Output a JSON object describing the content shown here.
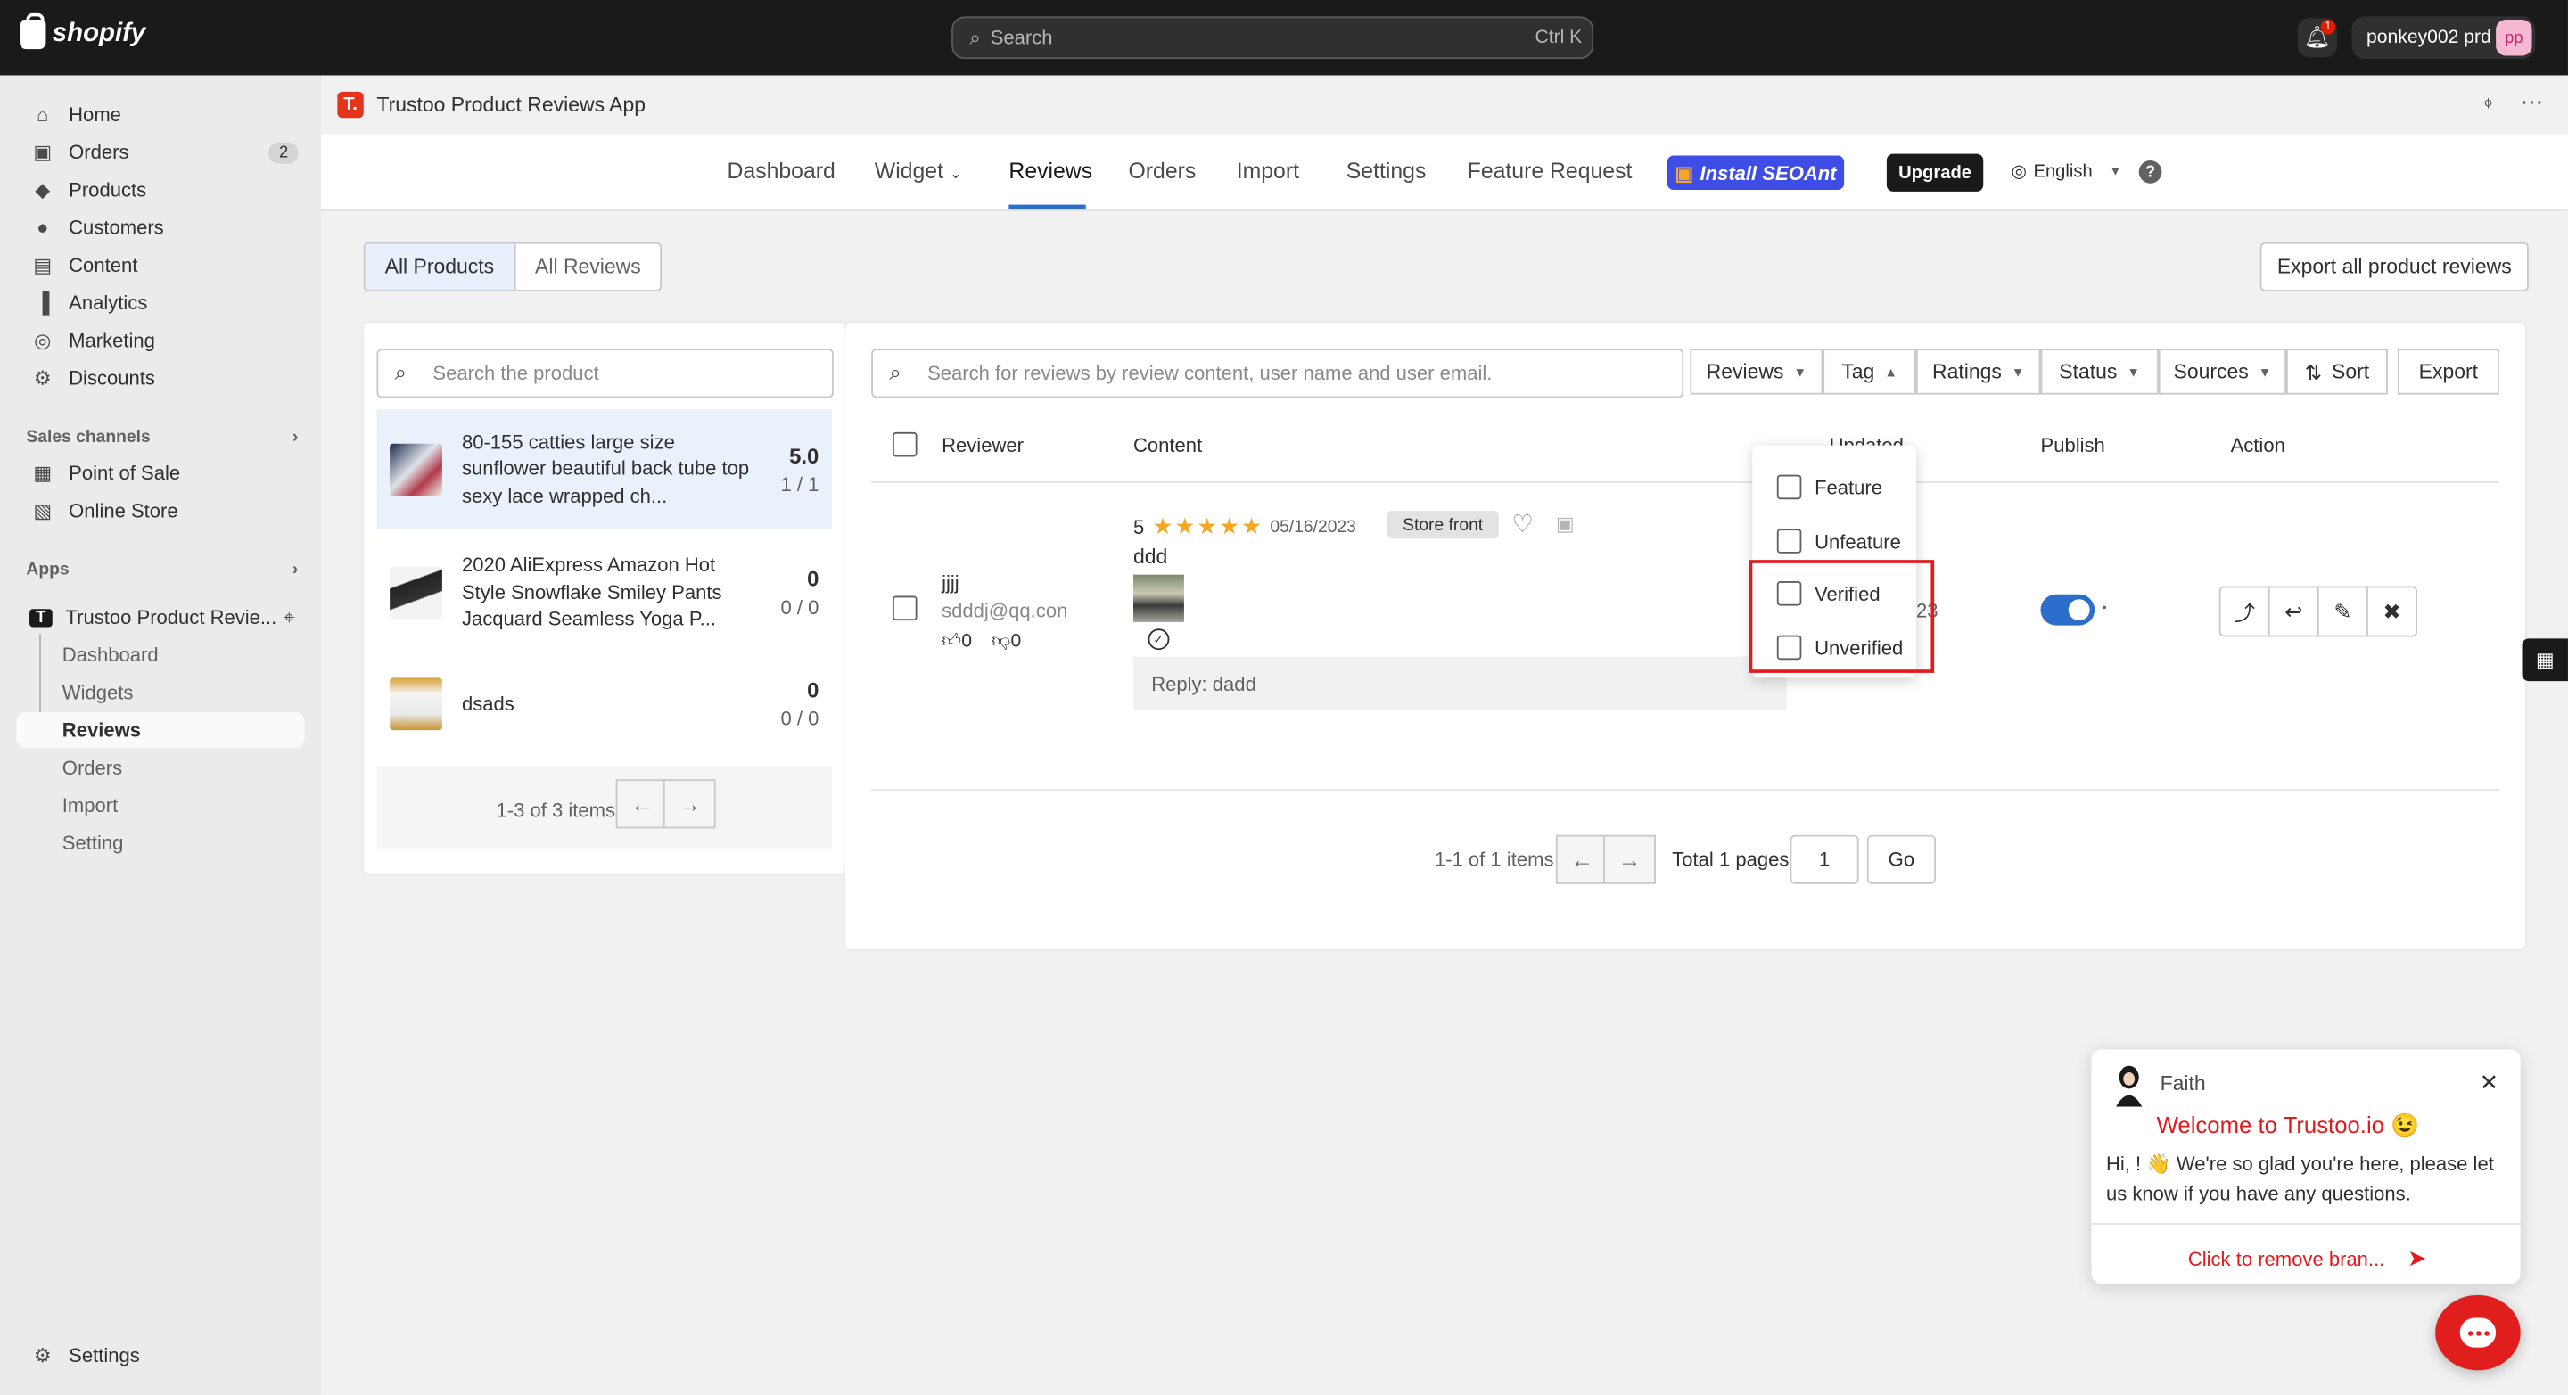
{
  "topbar": {
    "logo_text": "shopify",
    "search_placeholder": "Search",
    "search_shortcut": "Ctrl K",
    "notification_count": "1",
    "store_name": "ponkey002 prd",
    "avatar_initials": "pp"
  },
  "sidebar": {
    "items": [
      {
        "label": "Home",
        "icon": "home-icon"
      },
      {
        "label": "Orders",
        "icon": "orders-icon",
        "badge": "2"
      },
      {
        "label": "Products",
        "icon": "tag-icon"
      },
      {
        "label": "Customers",
        "icon": "person-icon"
      },
      {
        "label": "Content",
        "icon": "content-icon"
      },
      {
        "label": "Analytics",
        "icon": "chart-icon"
      },
      {
        "label": "Marketing",
        "icon": "target-icon"
      },
      {
        "label": "Discounts",
        "icon": "discount-icon"
      }
    ],
    "sales_channels_label": "Sales channels",
    "channels": [
      {
        "label": "Point of Sale",
        "icon": "pos-icon"
      },
      {
        "label": "Online Store",
        "icon": "store-icon"
      }
    ],
    "apps_label": "Apps",
    "app_name": "Trustoo Product Revie...",
    "app_subitems": [
      "Dashboard",
      "Widgets",
      "Reviews",
      "Orders",
      "Import",
      "Setting"
    ],
    "settings_label": "Settings"
  },
  "app": {
    "title": "Trustoo Product Reviews App",
    "logo_letter": "T.",
    "tabs": [
      "Dashboard",
      "Widget",
      "Reviews",
      "Orders",
      "Import",
      "Settings",
      "Feature Request"
    ],
    "active_tab": "Reviews",
    "seoant_label": "Install SEOAnt",
    "upgrade_label": "Upgrade",
    "language": "English",
    "help": "?"
  },
  "view_toggle": {
    "all_products": "All Products",
    "all_reviews": "All Reviews"
  },
  "export_all_label": "Export all product reviews",
  "products": {
    "search_placeholder": "Search the product",
    "list": [
      {
        "title": "80-155 catties large size sunflower beautiful back tube top sexy lace wrapped ch...",
        "score": "5.0",
        "count": "1 / 1"
      },
      {
        "title": "2020 AliExpress Amazon Hot Style Snowflake Smiley Pants Jacquard Seamless Yoga P...",
        "score": "0",
        "count": "0 / 0"
      },
      {
        "title": "dsads",
        "score": "0",
        "count": "0 / 0"
      }
    ],
    "pager_text": "1-3 of 3 items"
  },
  "reviews": {
    "search_placeholder": "Search for reviews by review content, user name and user email.",
    "filters": [
      "Reviews",
      "Tag",
      "Ratings",
      "Status",
      "Sources"
    ],
    "sort_label": "Sort",
    "export_label": "Export",
    "columns": {
      "reviewer": "Reviewer",
      "content": "Content",
      "updated": "Updated",
      "publish": "Publish",
      "action": "Action"
    },
    "rows": [
      {
        "reviewer_name": "jjjj",
        "reviewer_email": "sdddj@qq.con",
        "likes": "0",
        "dislikes": "0",
        "rating": "5",
        "stars": 5,
        "date": "05/16/2023",
        "source": "Store front",
        "text": "ddd",
        "reply": "Reply: dadd",
        "updated_partial": "23",
        "published": true
      }
    ],
    "tag_dropdown": [
      "Feature",
      "Unfeature",
      "Verified",
      "Unverified"
    ],
    "pager_text": "1-1 of 1 items",
    "total_pages_text": "Total 1 pages",
    "page_value": "1",
    "go_label": "Go"
  },
  "chat": {
    "agent_name": "Faith",
    "welcome": "Welcome to Trustoo.io 😉",
    "message": "Hi, ! 👋 We're so glad you're here, please let us know if you have any questions.",
    "remove_brand": "Click to remove bran..."
  }
}
